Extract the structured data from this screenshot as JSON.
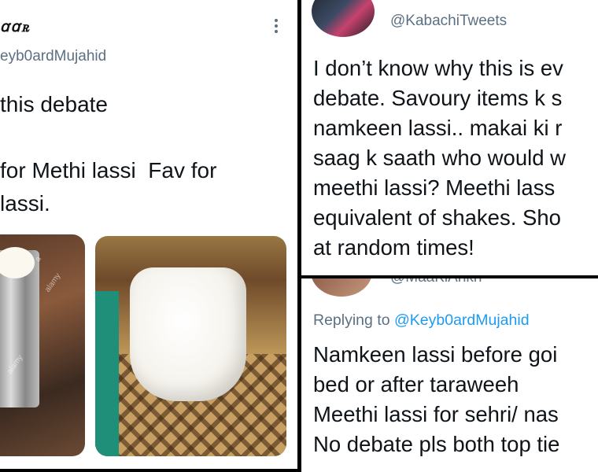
{
  "left_tweet": {
    "display_name": "ꭤꭤꭱ",
    "handle": "eyb0ardMujahid",
    "more_icon": "vertical-ellipsis-icon",
    "text_lines": [
      "this debate",
      "",
      "for Methi lassi  Fav for",
      "lassi."
    ],
    "images": {
      "watermark": "alamy",
      "watermark_a": "a"
    }
  },
  "right_top_tweet": {
    "handle": "@KabachiTweets",
    "text_lines": [
      "I don’t know why this is ev",
      "debate. Savoury items k s",
      "namkeen lassi.. makai ki r",
      "saag k saath who would w",
      "meethi lassi? Meethi lass",
      "equivalent of shakes. Sho",
      "at random times!"
    ]
  },
  "right_bottom_tweet": {
    "handle_cut": "@MaaKiAnkh",
    "replying_to_prefix": "Replying to",
    "replying_to_handle": "@Keyb0ardMujahid",
    "text_lines": [
      "Namkeen lassi before goi",
      "bed or after taraweeh",
      "Meethi lassi for sehri/ nas",
      "No debate pls both top tie"
    ]
  },
  "colors": {
    "background": "#000000",
    "card": "#ffffff",
    "text": "#0f1419",
    "secondary": "#5b7083",
    "link": "#1d9bf0"
  }
}
